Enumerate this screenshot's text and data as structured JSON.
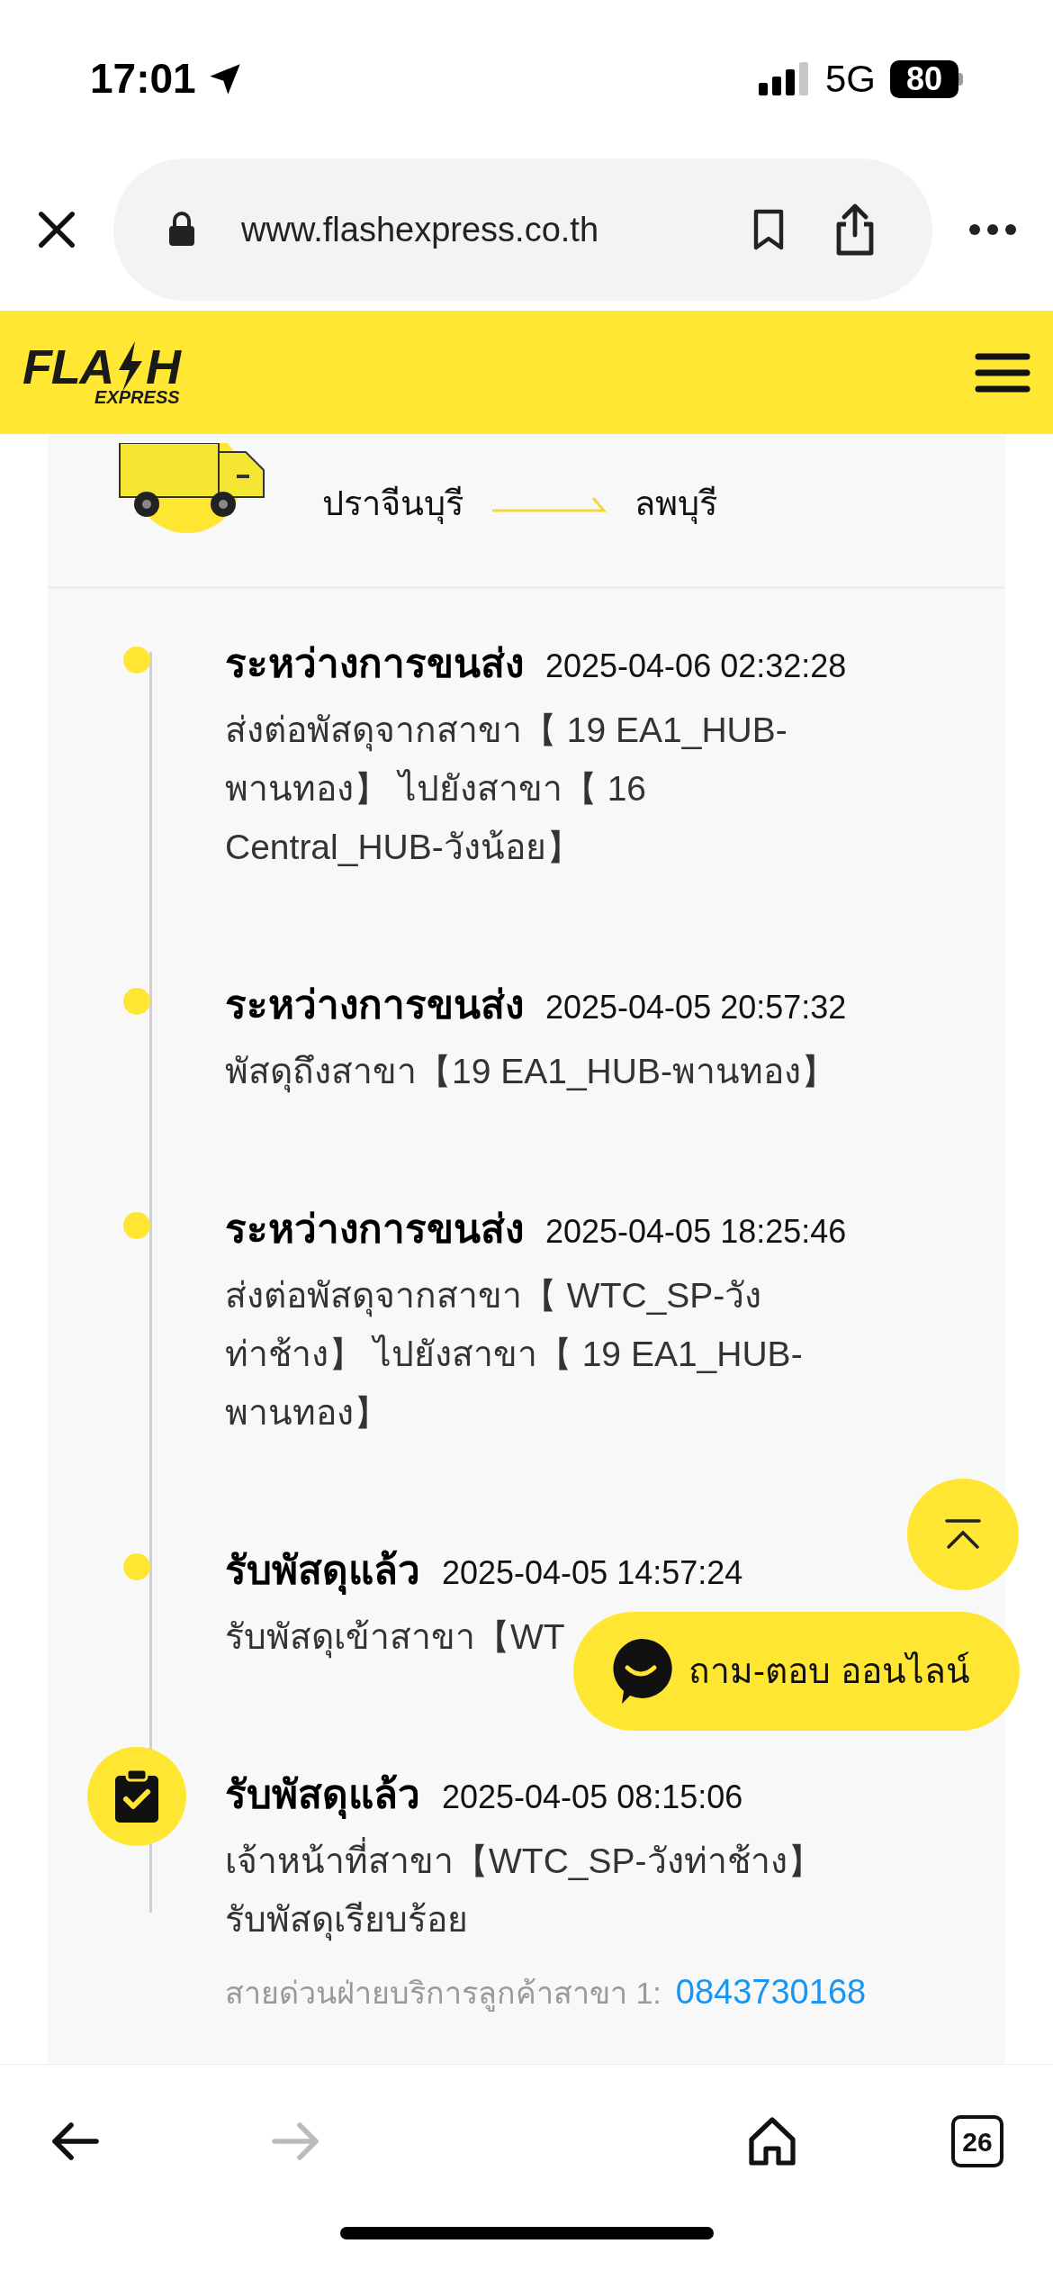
{
  "status_bar": {
    "time": "17:01",
    "network": "5G",
    "battery": "80"
  },
  "browser": {
    "url": "www.flashexpress.co.th"
  },
  "logo": {
    "letters_before": "FLA",
    "letters_after": "H",
    "tagline": "EXPRESS"
  },
  "route": {
    "origin": "ปราจีนบุรี",
    "destination": "ลพบุรี"
  },
  "timeline": [
    {
      "kind": "dot",
      "status": "ระหว่างการขนส่ง",
      "time": "2025-04-06 02:32:28",
      "description": "ส่งต่อพัสดุจากสาขา【 19 EA1_HUB-พานทอง】 ไปยังสาขา【 16 Central_HUB-วังน้อย】"
    },
    {
      "kind": "dot",
      "status": "ระหว่างการขนส่ง",
      "time": "2025-04-05 20:57:32",
      "description": "พัสดุถึงสาขา【19 EA1_HUB-พานทอง】"
    },
    {
      "kind": "dot",
      "status": "ระหว่างการขนส่ง",
      "time": "2025-04-05 18:25:46",
      "description": "ส่งต่อพัสดุจากสาขา【 WTC_SP-วังท่าช้าง】 ไปยังสาขา【 19 EA1_HUB-พานทอง】"
    },
    {
      "kind": "dot",
      "status": "รับพัสดุแล้ว",
      "time": "2025-04-05 14:57:24",
      "description": "รับพัสดุเข้าสาขา【WT"
    },
    {
      "kind": "received",
      "status": "รับพัสดุแล้ว",
      "time": "2025-04-05 08:15:06",
      "description": "เจ้าหน้าที่สาขา【WTC_SP-วังท่าช้าง】รับพัสดุเรียบร้อย",
      "hotline_label": "สายด่วนฝ่ายบริการลูกค้าสาขา 1:",
      "hotline_number": "0843730168"
    }
  ],
  "chat_button": {
    "label": "ถาม-ตอบ ออนไลน์"
  },
  "toolbar": {
    "forward_disabled": true,
    "tab_count": "26"
  }
}
